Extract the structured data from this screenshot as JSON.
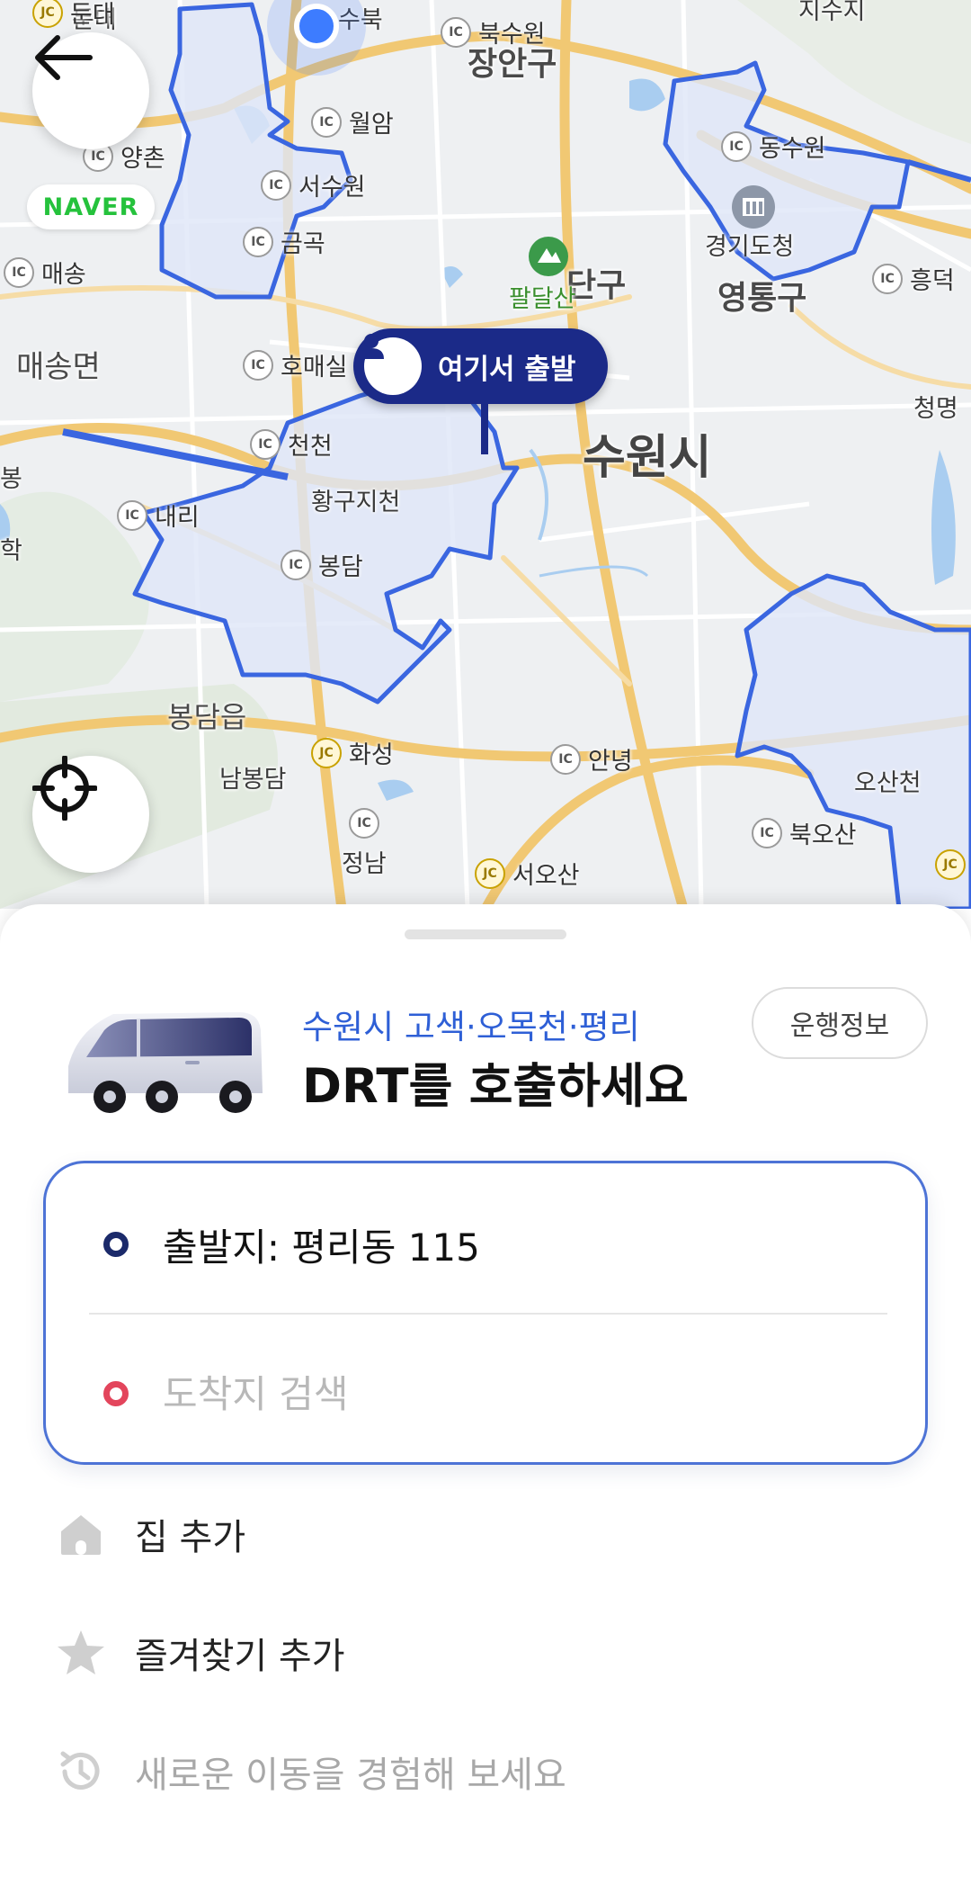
{
  "map": {
    "brand": "NAVER",
    "start_pin_label": "여기서 출발",
    "city_label": "수원시",
    "district_labels": [
      "장안구",
      "영통구",
      "매송면",
      "봉담읍"
    ],
    "partial_district": "단구",
    "mountain_label": "팔달산",
    "place_labels": [
      "황구지천",
      "오산천",
      "경기도청",
      "정남",
      "남봉담"
    ],
    "edge_labels": [
      "둔대",
      "수북",
      "지수지",
      "청명",
      "봉",
      "학"
    ],
    "interchanges": [
      {
        "type": "JC",
        "name": "둔대"
      },
      {
        "type": "IC",
        "name": "북수원"
      },
      {
        "type": "IC",
        "name": "월암"
      },
      {
        "type": "IC",
        "name": "양촌"
      },
      {
        "type": "IC",
        "name": "서수원"
      },
      {
        "type": "IC",
        "name": "금곡"
      },
      {
        "type": "IC",
        "name": "매송"
      },
      {
        "type": "IC",
        "name": "동수원"
      },
      {
        "type": "IC",
        "name": "흥덕"
      },
      {
        "type": "IC",
        "name": "호매실"
      },
      {
        "type": "IC",
        "name": "천천"
      },
      {
        "type": "IC",
        "name": "내리"
      },
      {
        "type": "IC",
        "name": "봉담"
      },
      {
        "type": "JC",
        "name": "화성"
      },
      {
        "type": "IC",
        "name": "안녕"
      },
      {
        "type": "IC",
        "name": "북오산"
      },
      {
        "type": "JC",
        "name": "서오산"
      },
      {
        "type": "JC",
        "name": "JC"
      },
      {
        "type": "IC",
        "name": ""
      }
    ],
    "colors": {
      "zone_fill": "#dfe6f8",
      "zone_stroke": "#3a66e0",
      "pin": "#1b2a88",
      "road_major": "#f3cf86",
      "water": "#a9cdf0"
    },
    "icons": [
      "back-arrow-icon",
      "crosshair-icon",
      "person-icon",
      "location-dot"
    ]
  },
  "sheet": {
    "service_area": "수원시 고색·오목천·평리",
    "title": "DRT를 호출하세요",
    "info_button": "운행정보",
    "origin": "출발지: 평리동 115",
    "destination_placeholder": "도착지 검색",
    "menu": [
      {
        "icon": "home-icon",
        "label": "집 추가"
      },
      {
        "icon": "star-icon",
        "label": "즐겨찾기 추가"
      },
      {
        "icon": "history-icon",
        "label": "새로운 이동을 경험해 보세요"
      }
    ],
    "colors": {
      "accent": "#2e5fd6",
      "origin_dot": "#1b2a6a",
      "destination_dot": "#e3455c"
    }
  }
}
